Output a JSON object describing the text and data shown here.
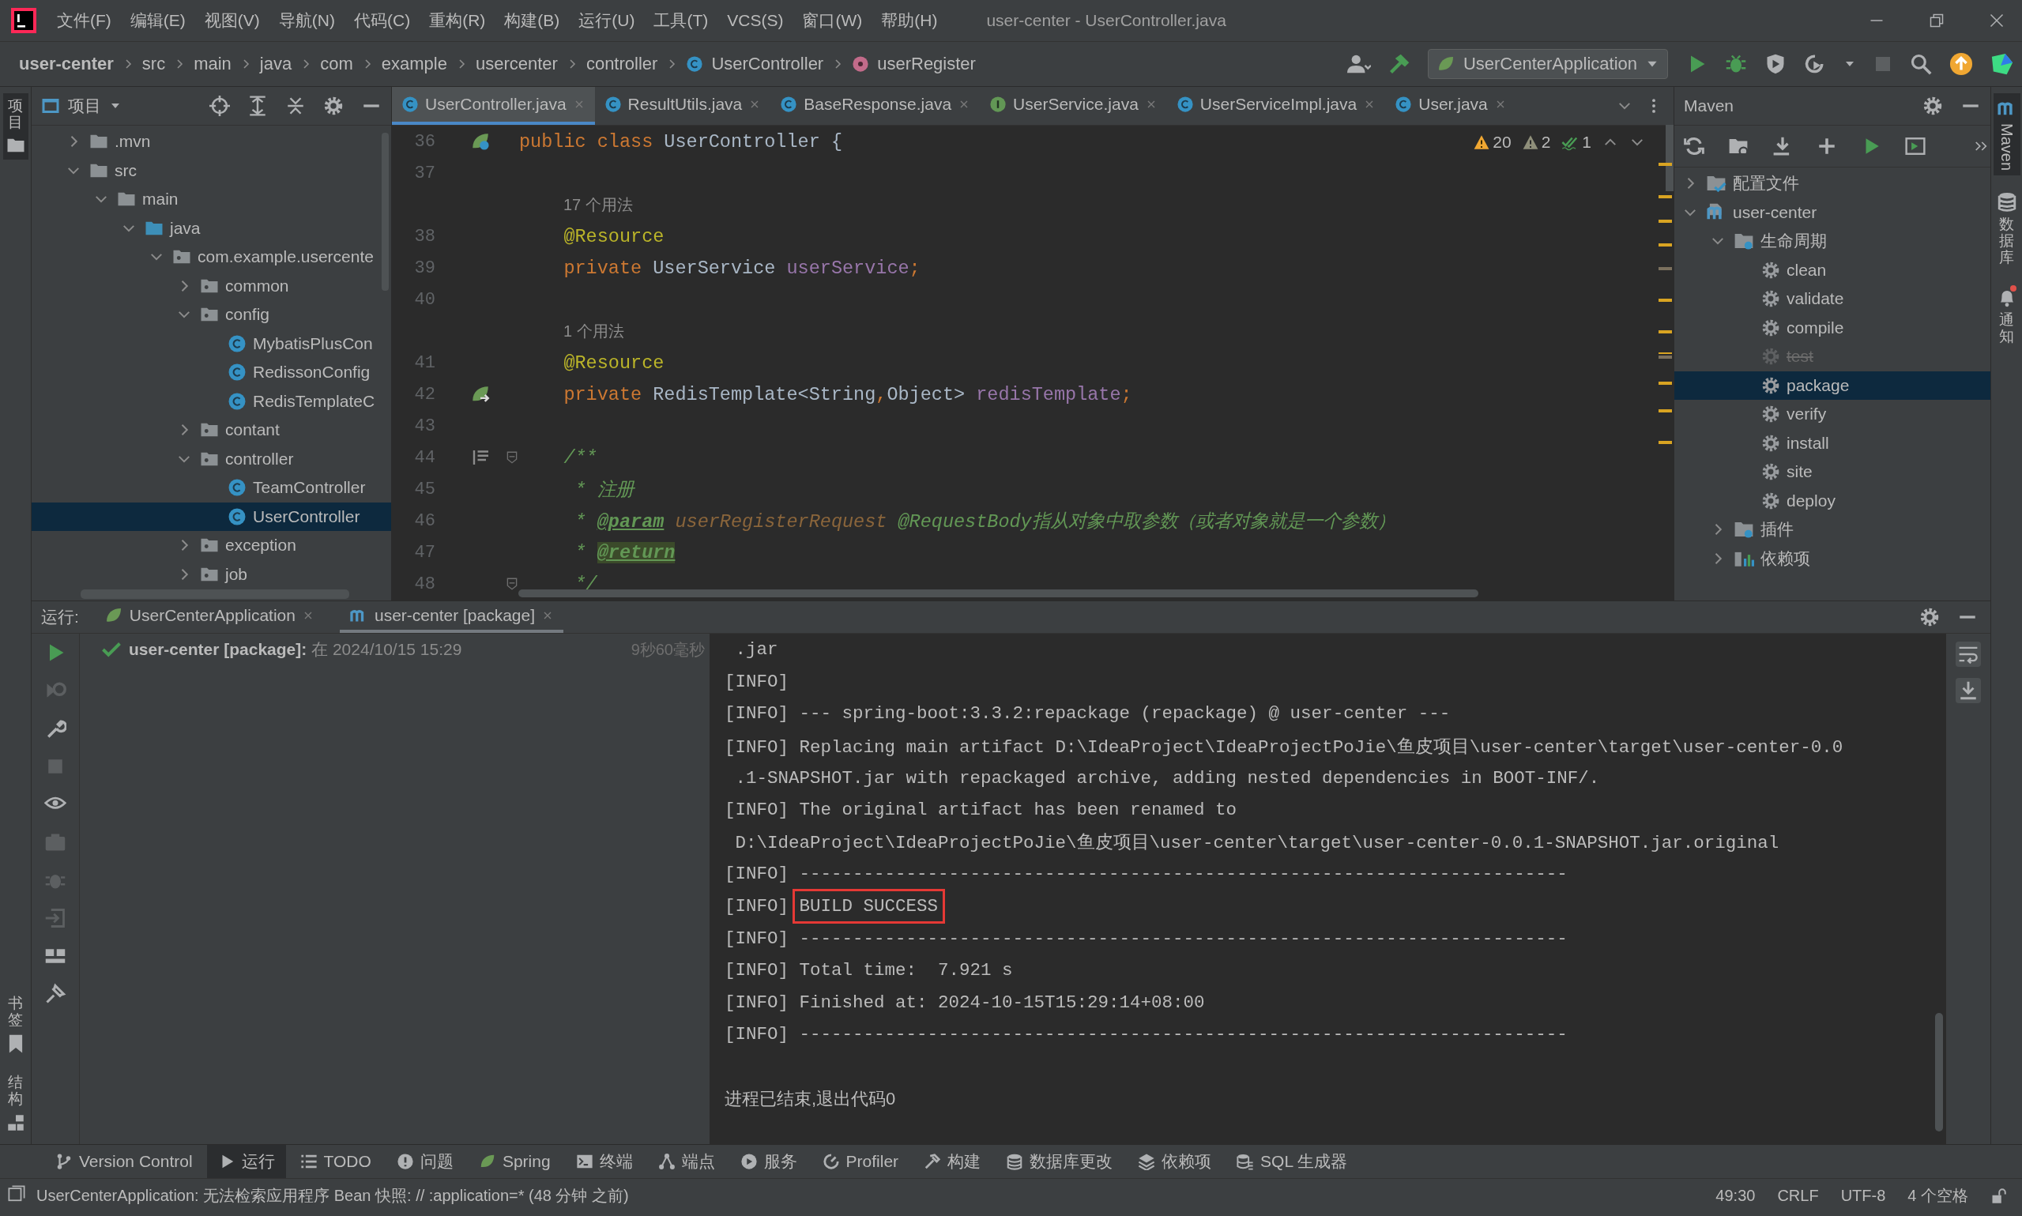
{
  "window": {
    "title": "user-center - UserController.java"
  },
  "menu": [
    "文件(F)",
    "编辑(E)",
    "视图(V)",
    "导航(N)",
    "代码(C)",
    "重构(R)",
    "构建(B)",
    "运行(U)",
    "工具(T)",
    "VCS(S)",
    "窗口(W)",
    "帮助(H)"
  ],
  "breadcrumbs": [
    {
      "label": "user-center",
      "kind": "project"
    },
    {
      "label": "src",
      "kind": "folder"
    },
    {
      "label": "main",
      "kind": "folder"
    },
    {
      "label": "java",
      "kind": "folder"
    },
    {
      "label": "com",
      "kind": "folder"
    },
    {
      "label": "example",
      "kind": "folder"
    },
    {
      "label": "usercenter",
      "kind": "folder"
    },
    {
      "label": "controller",
      "kind": "folder"
    },
    {
      "label": "UserController",
      "kind": "class"
    },
    {
      "label": "userRegister",
      "kind": "method"
    }
  ],
  "run_config": {
    "label": "UserCenterApplication"
  },
  "left_strip": {
    "top": [
      {
        "label": "项目",
        "selected": true
      }
    ],
    "bottom": [
      {
        "label": "书签",
        "kind": "bookmarks",
        "selected": false
      },
      {
        "label": "结构",
        "kind": "structure",
        "selected": false
      }
    ]
  },
  "right_strip": [
    {
      "label": "Maven",
      "kind": "maven",
      "selected": true,
      "badge": false
    },
    {
      "label": "数据库",
      "kind": "database",
      "selected": false,
      "badge": false
    },
    {
      "label": "通知",
      "kind": "notifications",
      "selected": false,
      "badge": true
    }
  ],
  "project": {
    "title": "项目",
    "tree": [
      {
        "label": ".mvn",
        "kind": "folder",
        "expanded": false,
        "selected": false
      },
      {
        "label": "src",
        "kind": "folder",
        "expanded": true,
        "selected": false,
        "children": [
          {
            "label": "main",
            "kind": "folder",
            "expanded": true,
            "selected": false,
            "children": [
              {
                "label": "java",
                "kind": "source-folder",
                "expanded": true,
                "selected": false,
                "children": [
                  {
                    "label": "com.example.usercente",
                    "kind": "package",
                    "expanded": true,
                    "selected": false,
                    "children": [
                      {
                        "label": "common",
                        "kind": "package",
                        "expanded": false,
                        "selected": false
                      },
                      {
                        "label": "config",
                        "kind": "package",
                        "expanded": true,
                        "selected": false,
                        "children": [
                          {
                            "label": "MybatisPlusCon",
                            "kind": "class",
                            "selected": false
                          },
                          {
                            "label": "RedissonConfig",
                            "kind": "class",
                            "selected": false
                          },
                          {
                            "label": "RedisTemplateC",
                            "kind": "class",
                            "selected": false
                          }
                        ]
                      },
                      {
                        "label": "contant",
                        "kind": "package",
                        "expanded": false,
                        "selected": false
                      },
                      {
                        "label": "controller",
                        "kind": "package",
                        "expanded": true,
                        "selected": false,
                        "children": [
                          {
                            "label": "TeamController",
                            "kind": "class",
                            "selected": false
                          },
                          {
                            "label": "UserController",
                            "kind": "class",
                            "selected": true
                          }
                        ]
                      },
                      {
                        "label": "exception",
                        "kind": "package",
                        "expanded": false,
                        "selected": false
                      },
                      {
                        "label": "job",
                        "kind": "package",
                        "expanded": false,
                        "selected": false
                      }
                    ]
                  }
                ]
              }
            ]
          }
        ]
      }
    ]
  },
  "editor": {
    "tabs": [
      {
        "label": "UserController.java",
        "kind": "class",
        "selected": true
      },
      {
        "label": "ResultUtils.java",
        "kind": "class",
        "selected": false
      },
      {
        "label": "BaseResponse.java",
        "kind": "class",
        "selected": false
      },
      {
        "label": "UserService.java",
        "kind": "interface",
        "selected": false
      },
      {
        "label": "UserServiceImpl.java",
        "kind": "class",
        "selected": false
      },
      {
        "label": "User.java",
        "kind": "class",
        "selected": false
      }
    ],
    "inspections": [
      {
        "kind": "warning",
        "count": "20"
      },
      {
        "kind": "weak-warning",
        "count": "2"
      },
      {
        "kind": "typo",
        "count": "1"
      }
    ],
    "lines": [
      {
        "kind": "code",
        "number": "36",
        "gutter": {
          "kind": "bean-class"
        },
        "tokens": [
          {
            "kind": "keyword",
            "text": "public class "
          },
          {
            "kind": "plain",
            "text": "UserController {"
          }
        ]
      },
      {
        "kind": "code",
        "number": "37"
      },
      {
        "kind": "hint",
        "text": "17 个用法"
      },
      {
        "kind": "code",
        "number": "38",
        "tokens": [
          {
            "kind": "annotation",
            "text": "    @Resource"
          }
        ]
      },
      {
        "kind": "code",
        "number": "39",
        "tokens": [
          {
            "kind": "keyword",
            "text": "    private "
          },
          {
            "kind": "plain",
            "text": "UserService "
          },
          {
            "kind": "field",
            "text": "userService"
          },
          {
            "kind": "keyword",
            "text": ";"
          }
        ]
      },
      {
        "kind": "code",
        "number": "40"
      },
      {
        "kind": "hint",
        "text": "1 个用法"
      },
      {
        "kind": "code",
        "number": "41",
        "tokens": [
          {
            "kind": "annotation",
            "text": "    @Resource"
          }
        ]
      },
      {
        "kind": "code",
        "number": "42",
        "gutter": {
          "kind": "bean-link"
        },
        "tokens": [
          {
            "kind": "keyword",
            "text": "    private "
          },
          {
            "kind": "plain",
            "text": "RedisTemplate<String"
          },
          {
            "kind": "keyword",
            "text": ","
          },
          {
            "kind": "plain",
            "text": "Object> "
          },
          {
            "kind": "field",
            "text": "redisTemplate"
          },
          {
            "kind": "keyword",
            "text": ";"
          }
        ]
      },
      {
        "kind": "code",
        "number": "43"
      },
      {
        "kind": "code",
        "number": "44",
        "gutter": {
          "kind": "doc-render"
        },
        "fold": true,
        "tokens": [
          {
            "kind": "doc",
            "text": "    /**"
          }
        ]
      },
      {
        "kind": "code",
        "number": "45",
        "tokens": [
          {
            "kind": "doc",
            "text": "     * 注册"
          }
        ]
      },
      {
        "kind": "code",
        "number": "46",
        "tokens": [
          {
            "kind": "doc",
            "text": "     * "
          },
          {
            "kind": "doc-tag",
            "text": "@param"
          },
          {
            "kind": "doc-param",
            "text": " userRegisterRequest"
          },
          {
            "kind": "doc",
            "text": " @RequestBody指从对象中取参数（或者对象就是一个参数）"
          }
        ]
      },
      {
        "kind": "code",
        "number": "47",
        "tokens": [
          {
            "kind": "doc",
            "text": "     * "
          },
          {
            "kind": "doc-tag-marked",
            "text": "@return"
          }
        ]
      },
      {
        "kind": "code",
        "number": "48",
        "fold": true,
        "tokens": [
          {
            "kind": "doc",
            "text": "     */"
          }
        ]
      }
    ]
  },
  "maven": {
    "title": "Maven",
    "tree": [
      {
        "label": "配置文件",
        "kind": "profiles",
        "expanded": false,
        "selected": false
      },
      {
        "label": "user-center",
        "kind": "module",
        "expanded": true,
        "selected": false,
        "children": [
          {
            "label": "生命周期",
            "kind": "lifecycle",
            "expanded": true,
            "selected": false,
            "children": [
              {
                "label": "clean",
                "kind": "goal",
                "selected": false,
                "disabled": false
              },
              {
                "label": "validate",
                "kind": "goal",
                "selected": false,
                "disabled": false
              },
              {
                "label": "compile",
                "kind": "goal",
                "selected": false,
                "disabled": false
              },
              {
                "label": "test",
                "kind": "goal",
                "selected": false,
                "disabled": true
              },
              {
                "label": "package",
                "kind": "goal",
                "selected": true,
                "disabled": false
              },
              {
                "label": "verify",
                "kind": "goal",
                "selected": false,
                "disabled": false
              },
              {
                "label": "install",
                "kind": "goal",
                "selected": false,
                "disabled": false
              },
              {
                "label": "site",
                "kind": "goal",
                "selected": false,
                "disabled": false
              },
              {
                "label": "deploy",
                "kind": "goal",
                "selected": false,
                "disabled": false
              }
            ]
          },
          {
            "label": "插件",
            "kind": "plugins",
            "expanded": false,
            "selected": false
          },
          {
            "label": "依赖项",
            "kind": "dependencies",
            "expanded": false,
            "selected": false
          }
        ]
      }
    ]
  },
  "run": {
    "label": "运行:",
    "tabs": [
      {
        "label": "UserCenterApplication",
        "kind": "spring",
        "selected": false
      },
      {
        "label": "user-center [package]",
        "kind": "maven",
        "selected": true
      }
    ],
    "toolbar": [
      {
        "kind": "rerun",
        "disabled": false
      },
      {
        "kind": "rerun-failed",
        "disabled": true
      },
      {
        "kind": "settings",
        "disabled": false
      },
      {
        "kind": "stop",
        "disabled": true
      },
      {
        "kind": "view",
        "disabled": false
      },
      {
        "kind": "snapshot",
        "disabled": true
      },
      {
        "kind": "debug",
        "disabled": true
      },
      {
        "kind": "import",
        "disabled": true
      },
      {
        "kind": "layout",
        "disabled": false
      },
      {
        "kind": "pin",
        "disabled": false
      }
    ],
    "entry": {
      "name": "user-center [package]:",
      "time": "在 2024/10/15 15:29",
      "duration": "9秒60毫秒",
      "kind": "success"
    },
    "console": [
      {
        "kind": "log",
        "parts": [
          {
            "text": " .jar"
          }
        ]
      },
      {
        "kind": "log",
        "parts": [
          {
            "text": "[INFO]"
          }
        ]
      },
      {
        "kind": "log",
        "parts": [
          {
            "text": "[INFO] --- spring-boot:3.3.2:repackage (repackage) @ user-center ---"
          }
        ]
      },
      {
        "kind": "log",
        "parts": [
          {
            "text": "[INFO] Replacing main artifact D:\\IdeaProject\\IdeaProjectPoJie\\鱼皮项目\\user-center\\target\\user-center-0.0"
          }
        ]
      },
      {
        "kind": "log",
        "parts": [
          {
            "text": " .1-SNAPSHOT.jar with repackaged archive, adding nested dependencies in BOOT-INF/."
          }
        ]
      },
      {
        "kind": "log",
        "parts": [
          {
            "text": "[INFO] The original artifact has been renamed to"
          }
        ]
      },
      {
        "kind": "log",
        "parts": [
          {
            "text": " D:\\IdeaProject\\IdeaProjectPoJie\\鱼皮项目\\user-center\\target\\user-center-0.0.1-SNAPSHOT.jar.original"
          }
        ]
      },
      {
        "kind": "log",
        "parts": [
          {
            "text": "[INFO] ------------------------------------------------------------------------"
          }
        ]
      },
      {
        "kind": "log",
        "parts": [
          {
            "text": "[INFO] "
          },
          {
            "text": "BUILD SUCCESS",
            "boxed": true
          }
        ]
      },
      {
        "kind": "log",
        "parts": [
          {
            "text": "[INFO] ------------------------------------------------------------------------"
          }
        ]
      },
      {
        "kind": "log",
        "parts": [
          {
            "text": "[INFO] Total time:  7.921 s"
          }
        ]
      },
      {
        "kind": "log",
        "parts": [
          {
            "text": "[INFO] Finished at: 2024-10-15T15:29:14+08:00"
          }
        ]
      },
      {
        "kind": "log",
        "parts": [
          {
            "text": "[INFO] ------------------------------------------------------------------------"
          }
        ]
      },
      {
        "kind": "exit",
        "parts": [
          {
            "text": "进程已结束,退出代码0"
          }
        ]
      }
    ]
  },
  "tool_windows": [
    {
      "label": "Version Control",
      "kind": "vcs",
      "selected": false
    },
    {
      "label": "运行",
      "kind": "run",
      "selected": true
    },
    {
      "label": "TODO",
      "kind": "todo",
      "selected": false
    },
    {
      "label": "问题",
      "kind": "problems",
      "selected": false
    },
    {
      "label": "Spring",
      "kind": "spring",
      "selected": false
    },
    {
      "label": "终端",
      "kind": "terminal",
      "selected": false
    },
    {
      "label": "端点",
      "kind": "endpoints",
      "selected": false
    },
    {
      "label": "服务",
      "kind": "services",
      "selected": false
    },
    {
      "label": "Profiler",
      "kind": "profiler",
      "selected": false
    },
    {
      "label": "构建",
      "kind": "build",
      "selected": false
    },
    {
      "label": "数据库更改",
      "kind": "database",
      "selected": false
    },
    {
      "label": "依赖项",
      "kind": "dependencies",
      "selected": false
    },
    {
      "label": "SQL 生成器",
      "kind": "sql",
      "selected": false
    }
  ],
  "status_bar": {
    "message": "UserCenterApplication: 无法检索应用程序 Bean 快照: // :application=* (48 分钟 之前)",
    "items": [
      "49:30",
      "CRLF",
      "UTF-8",
      "4 个空格"
    ]
  }
}
